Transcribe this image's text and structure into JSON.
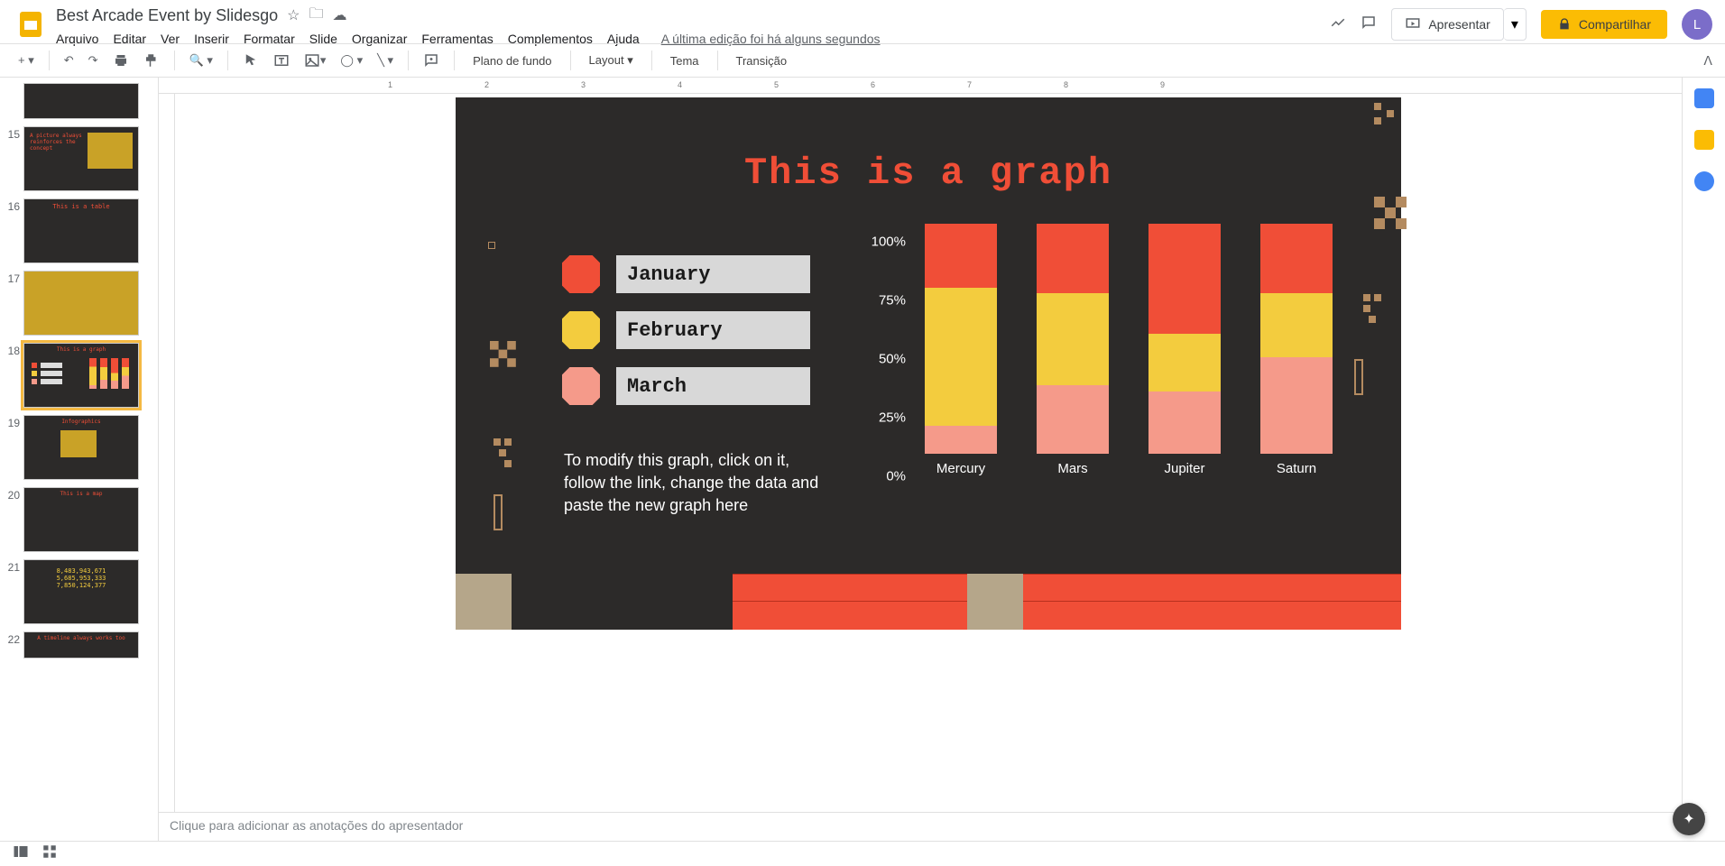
{
  "app": {
    "title": "Best Arcade Event by Slidesgo",
    "last_edit": "A última edição foi há alguns segundos",
    "avatar_initial": "L"
  },
  "menus": [
    "Arquivo",
    "Editar",
    "Ver",
    "Inserir",
    "Formatar",
    "Slide",
    "Organizar",
    "Ferramentas",
    "Complementos",
    "Ajuda"
  ],
  "buttons": {
    "present": "Apresentar",
    "share": "Compartilhar"
  },
  "toolbar": {
    "background": "Plano de fundo",
    "layout": "Layout",
    "theme": "Tema",
    "transition": "Transição"
  },
  "notes_placeholder": "Clique para adicionar as anotações do apresentador",
  "ruler_marks": [
    "1",
    "2",
    "3",
    "4",
    "5",
    "6",
    "7",
    "8",
    "9"
  ],
  "thumbs": [
    15,
    16,
    17,
    18,
    19,
    20,
    21,
    22
  ],
  "slide": {
    "title": "This is a graph",
    "legend": [
      "January",
      "February",
      "March"
    ],
    "helper": "To modify this graph, click on it, follow the link, change the data and paste the new graph here"
  },
  "colors": {
    "jan": "#f04e37",
    "feb": "#f3cc3e",
    "mar": "#f59a8a",
    "slide_bg": "#2c2a29"
  },
  "chart_data": {
    "type": "bar",
    "stacked": true,
    "title": "This is a graph",
    "xlabel": "",
    "ylabel": "",
    "ylim": [
      0,
      100
    ],
    "yticks": [
      "0%",
      "25%",
      "50%",
      "75%",
      "100%"
    ],
    "categories": [
      "Mercury",
      "Mars",
      "Jupiter",
      "Saturn"
    ],
    "series": [
      {
        "name": "March",
        "color": "#f59a8a",
        "values": [
          12,
          30,
          27,
          42
        ]
      },
      {
        "name": "February",
        "color": "#f3cc3e",
        "values": [
          60,
          40,
          25,
          28
        ]
      },
      {
        "name": "January",
        "color": "#f04e37",
        "values": [
          28,
          30,
          48,
          30
        ]
      }
    ]
  }
}
